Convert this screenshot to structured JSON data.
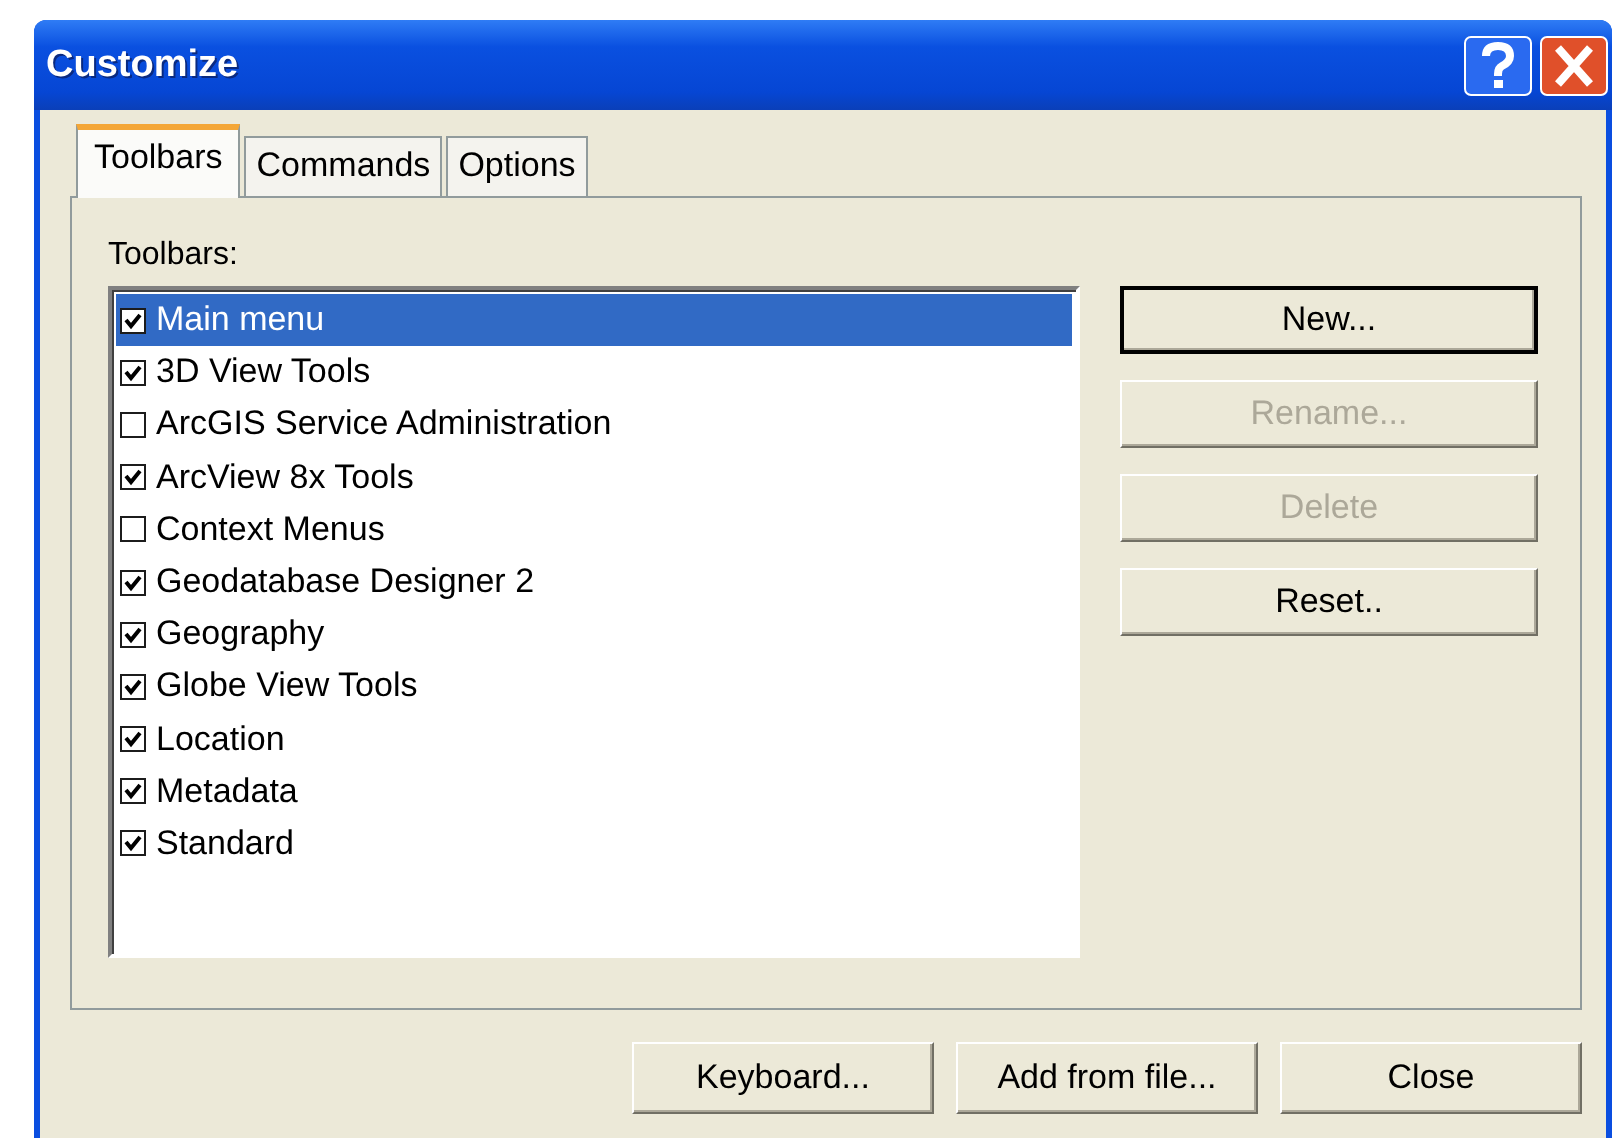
{
  "window": {
    "title": "Customize"
  },
  "tabs": [
    {
      "label": "Toolbars",
      "selected": true
    },
    {
      "label": "Commands",
      "selected": false
    },
    {
      "label": "Options",
      "selected": false
    }
  ],
  "toolbars_label": "Toolbars:",
  "toolbars": [
    {
      "label": "Main menu",
      "checked": true,
      "selected": true
    },
    {
      "label": "3D View Tools",
      "checked": true,
      "selected": false
    },
    {
      "label": "ArcGIS Service Administration",
      "checked": false,
      "selected": false
    },
    {
      "label": "ArcView 8x Tools",
      "checked": true,
      "selected": false
    },
    {
      "label": "Context Menus",
      "checked": false,
      "selected": false
    },
    {
      "label": "Geodatabase Designer 2",
      "checked": true,
      "selected": false
    },
    {
      "label": "Geography",
      "checked": true,
      "selected": false
    },
    {
      "label": "Globe View Tools",
      "checked": true,
      "selected": false
    },
    {
      "label": "Location",
      "checked": true,
      "selected": false
    },
    {
      "label": "Metadata",
      "checked": true,
      "selected": false
    },
    {
      "label": "Standard",
      "checked": true,
      "selected": false
    }
  ],
  "side_buttons": [
    {
      "label": "New...",
      "disabled": false,
      "default": true
    },
    {
      "label": "Rename...",
      "disabled": true,
      "default": false
    },
    {
      "label": "Delete",
      "disabled": true,
      "default": false
    },
    {
      "label": "Reset..",
      "disabled": false,
      "default": false
    }
  ],
  "footer_buttons": [
    "Keyboard...",
    "Add from file...",
    "Close"
  ]
}
